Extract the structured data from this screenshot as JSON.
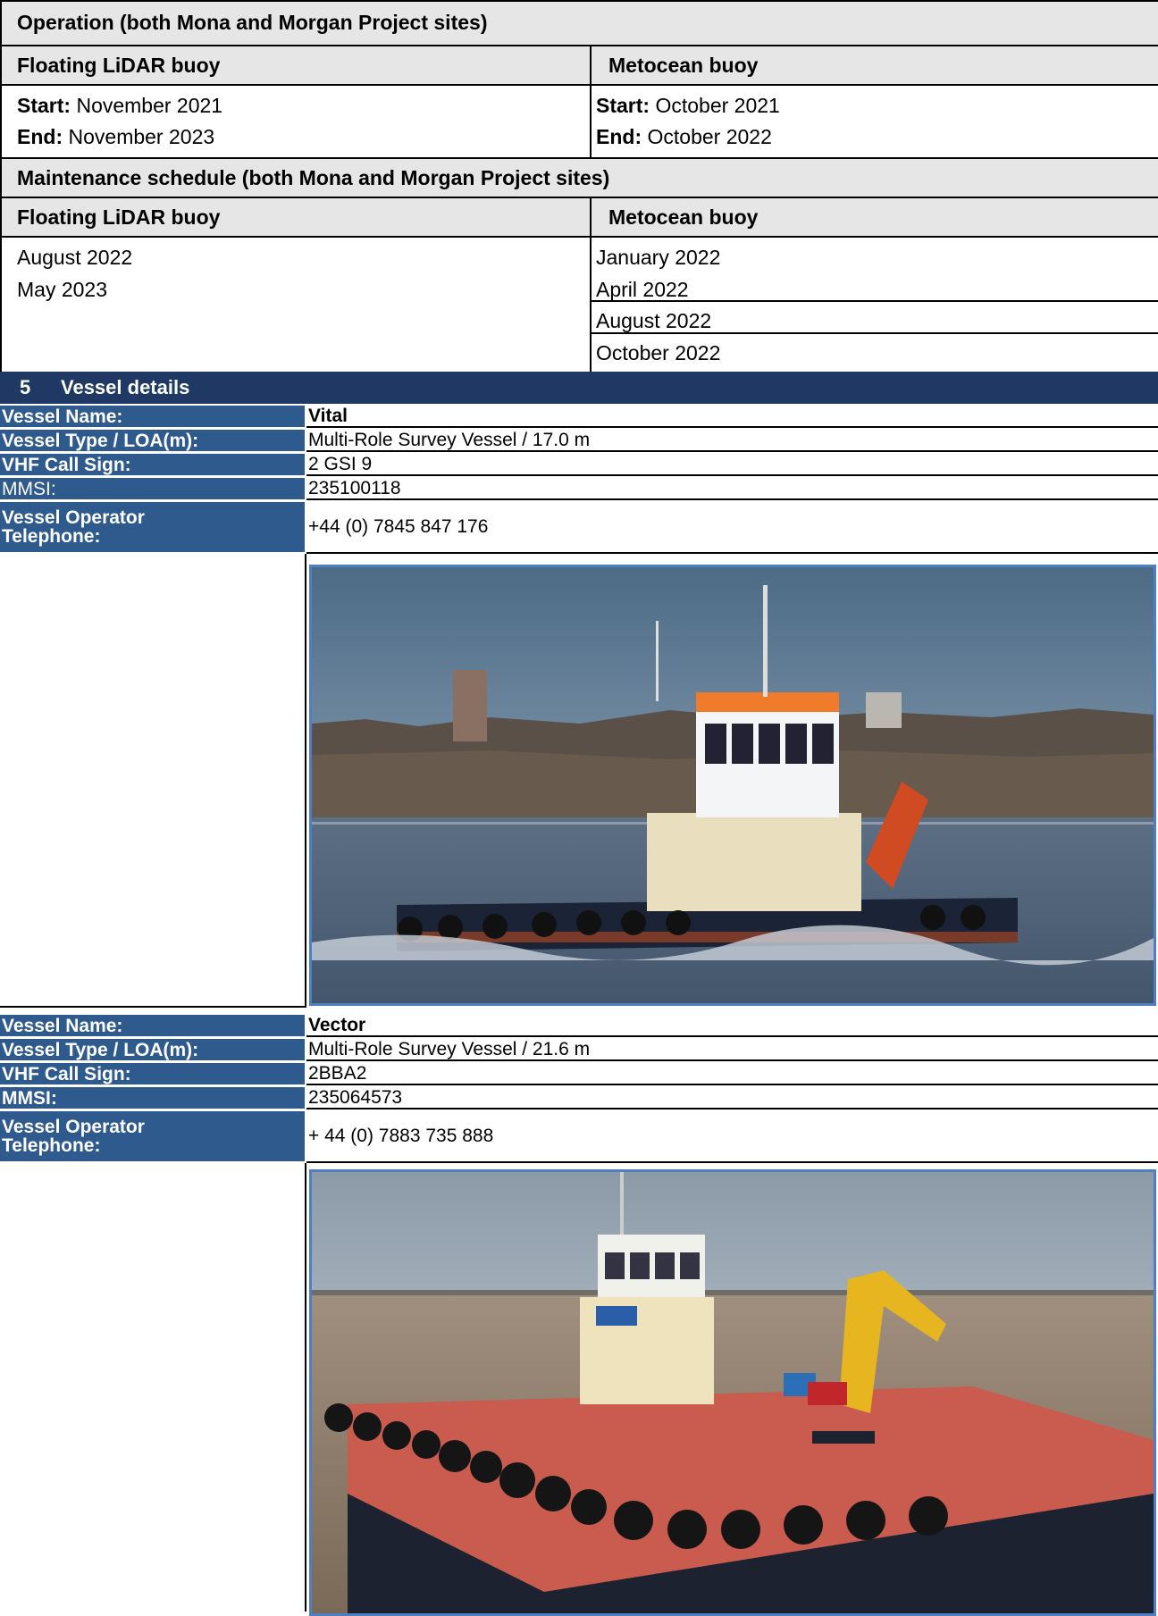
{
  "operation": {
    "title": "Operation (both Mona and Morgan Project sites)",
    "col1_header": "Floating LiDAR buoy",
    "col2_header": "Metocean buoy",
    "lidar": {
      "start_label": "Start:",
      "start_value": " November 2021",
      "end_label": "End:",
      "end_value": " November 2023"
    },
    "metocean": {
      "start_label": "Start:",
      "start_value": " October 2021",
      "end_label": "End:",
      "end_value": " October 2022"
    }
  },
  "maintenance": {
    "title": "Maintenance schedule (both Mona and Morgan Project sites)",
    "col1_header": "Floating LiDAR buoy",
    "col2_header": "Metocean buoy",
    "lidar_dates": [
      "August 2022",
      "May 2023"
    ],
    "metocean_dates": [
      "January 2022",
      "April 2022",
      "August 2022",
      "October 2022"
    ]
  },
  "section": {
    "number": "5",
    "title": "Vessel details"
  },
  "vessels": [
    {
      "labels": {
        "name": "Vessel Name:",
        "type": "Vessel Type / LOA(m):",
        "vhf": "VHF Call Sign:",
        "mmsi": "MMSI:",
        "phone": "Vessel Operator Telephone:"
      },
      "name": "Vital",
      "type": "Multi-Role Survey Vessel / 17.0 m",
      "vhf": "2 GSI 9",
      "mmsi": "235100118",
      "phone": "+44 (0) 7845 847 176"
    },
    {
      "labels": {
        "name": "Vessel Name:",
        "type": "Vessel Type / LOA(m):",
        "vhf": "VHF Call Sign:",
        "mmsi": "MMSI:",
        "phone": "Vessel Operator Telephone:"
      },
      "name": "Vector",
      "type": "Multi-Role Survey Vessel / 21.6 m",
      "vhf": "2BBA2",
      "mmsi": "235064573",
      "phone": "+ 44 (0) 7883 735 888"
    }
  ],
  "colors": {
    "section_bar": "#1f3864",
    "label_bg": "#2e5a8e",
    "header_bg": "#e6e6e6",
    "photo_border": "#4f7fc3"
  }
}
